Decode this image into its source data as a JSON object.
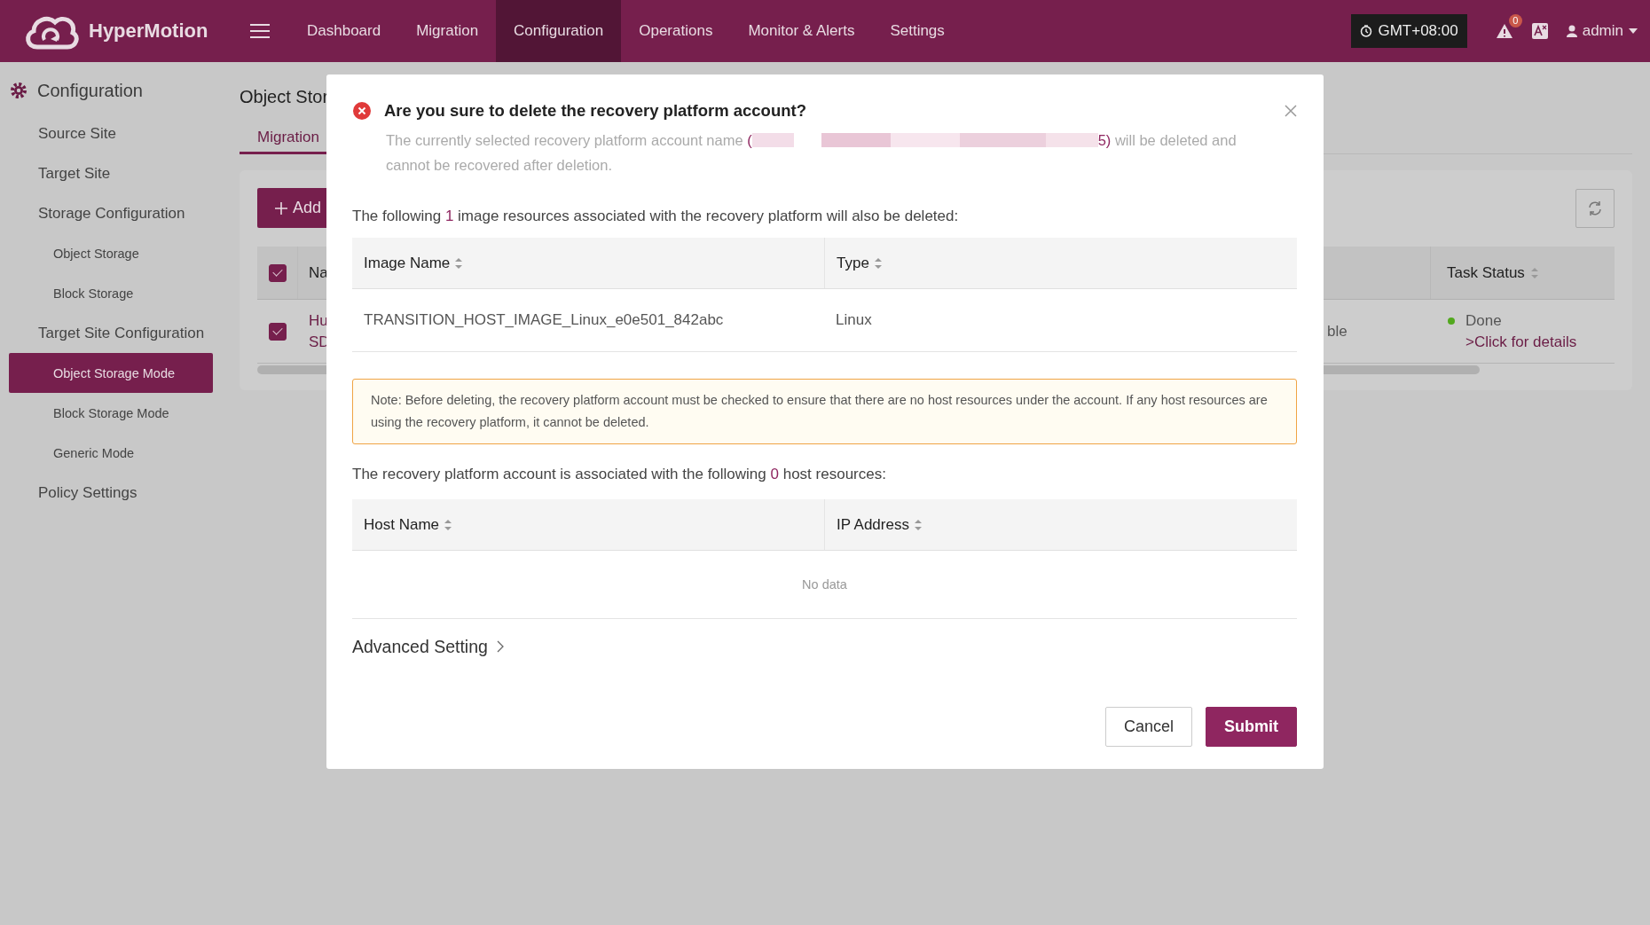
{
  "header": {
    "logo": "HyperMotion",
    "nav": [
      {
        "label": "Dashboard",
        "selected": false
      },
      {
        "label": "Migration",
        "selected": false
      },
      {
        "label": "Configuration",
        "selected": true
      },
      {
        "label": "Operations",
        "selected": false
      },
      {
        "label": "Monitor & Alerts",
        "selected": false
      },
      {
        "label": "Settings",
        "selected": false
      }
    ],
    "timezone": "GMT+08:00",
    "alert_count": "0",
    "user": "admin"
  },
  "sidebar": {
    "title": "Configuration",
    "items": [
      {
        "label": "Source Site",
        "selected": false
      },
      {
        "label": "Target Site",
        "selected": false
      },
      {
        "label": "Storage Configuration",
        "selected": false,
        "children": [
          {
            "label": "Object Storage",
            "selected": false
          },
          {
            "label": "Block Storage",
            "selected": false
          }
        ]
      },
      {
        "label": "Target Site Configuration",
        "selected": false,
        "children": [
          {
            "label": "Object Storage Mode",
            "selected": true
          },
          {
            "label": "Block Storage Mode",
            "selected": false
          },
          {
            "label": "Generic Mode",
            "selected": false
          }
        ]
      },
      {
        "label": "Policy Settings",
        "selected": false
      }
    ]
  },
  "page": {
    "title": "Object Stor",
    "tabs": [
      {
        "label": "Migration",
        "selected": true
      }
    ],
    "add_button": "Add",
    "table": {
      "header_checked": true,
      "columns": [
        "Na",
        "",
        "Task Status"
      ],
      "rows": [
        {
          "checked": true,
          "name_lines": [
            "Hu",
            "SD"
          ],
          "column_2": "ble",
          "status": "Done",
          "details_link": ">Click for details"
        }
      ]
    }
  },
  "dialog": {
    "title": "Are you sure to delete the recovery platform account?",
    "description": {
      "before": "The currently selected recovery platform account name ",
      "name_start": "(",
      "name_end": "5)",
      "after": " will be deleted and cannot be recovered after deletion."
    },
    "images_intro": {
      "before": "The following ",
      "count": "1",
      "after": " image resources associated with the recovery platform will also be deleted:"
    },
    "images_table": {
      "columns": [
        "Image Name",
        "Type"
      ],
      "rows": [
        [
          "TRANSITION_HOST_IMAGE_Linux_e0e501_842abc",
          "Linux"
        ]
      ]
    },
    "note": "Note: Before deleting, the recovery platform account must be checked to ensure that there are no host resources under the account. If any host resources are using the recovery platform, it cannot be deleted.",
    "hosts_intro": {
      "before": "The recovery platform account is associated with the following ",
      "count": "0",
      "after": " host resources:"
    },
    "hosts_table": {
      "columns": [
        "Host Name",
        "IP Address"
      ],
      "empty": "No data"
    },
    "advanced": "Advanced Setting",
    "buttons": [
      {
        "label": "Cancel",
        "kind": "default"
      },
      {
        "label": "Submit",
        "kind": "primary"
      }
    ]
  }
}
